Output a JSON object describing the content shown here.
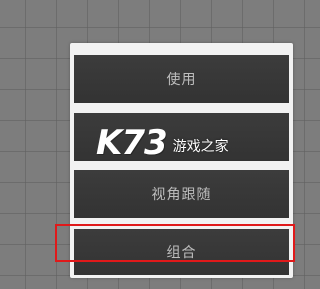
{
  "menu": {
    "items": [
      {
        "label": "使用"
      },
      {
        "label": ""
      },
      {
        "label": "视角跟随"
      },
      {
        "label": "组合"
      }
    ],
    "highlighted_index": 3
  },
  "watermark": {
    "logo": "K73",
    "text": "游戏之家"
  },
  "colors": {
    "background": "#7d7d7d",
    "button": "#383838",
    "button_text": "#bdbdbd",
    "panel": "#f2f2f2",
    "highlight": "#e0191a"
  }
}
